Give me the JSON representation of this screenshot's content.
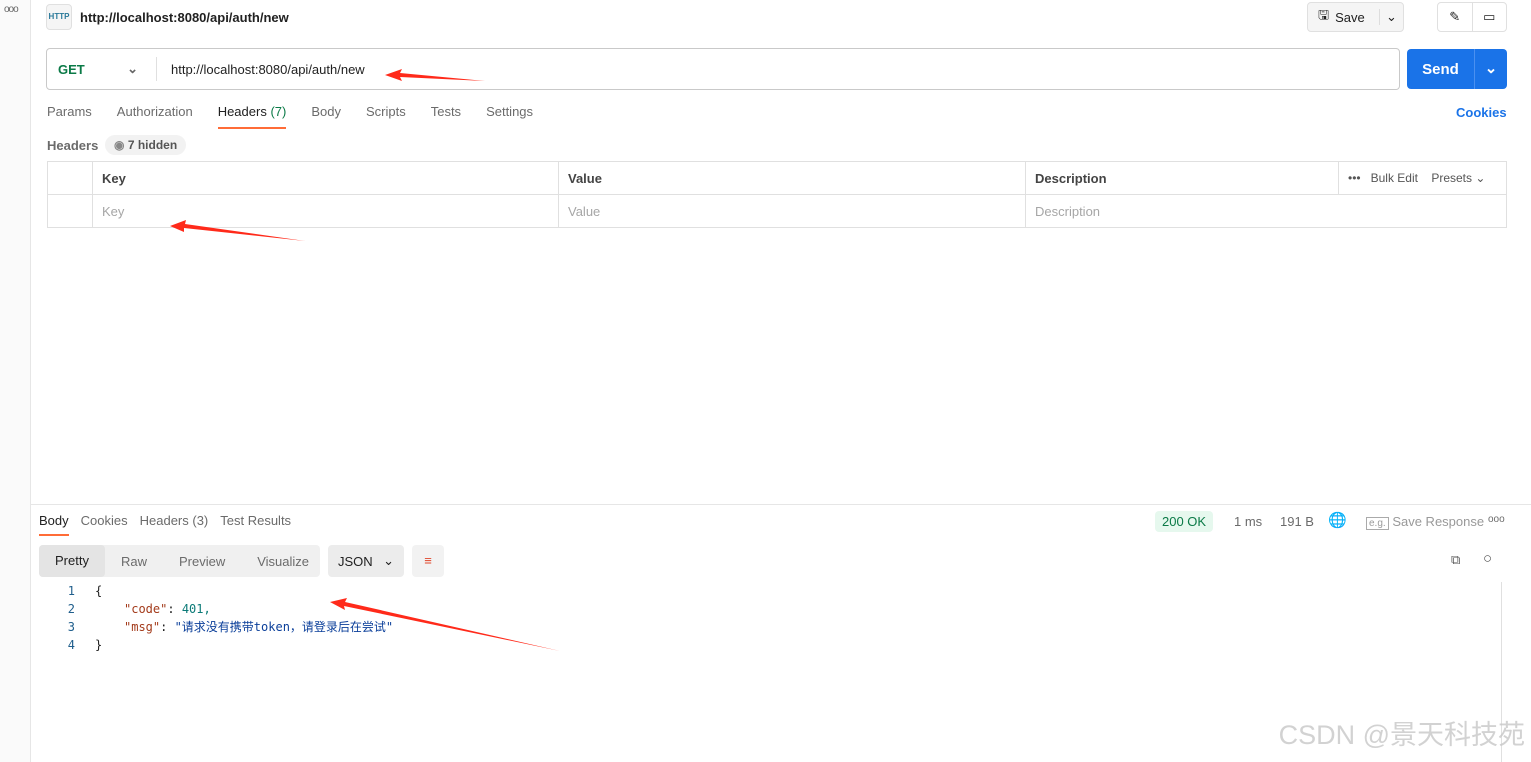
{
  "request": {
    "title": "http://localhost:8080/api/auth/new",
    "icon_text": "HTTP",
    "method": "GET",
    "url": "http://localhost:8080/api/auth/new",
    "save_label": "Save",
    "send_label": "Send"
  },
  "tabs": [
    {
      "label": "Params"
    },
    {
      "label": "Authorization"
    },
    {
      "label": "Headers",
      "count": "(7)"
    },
    {
      "label": "Body"
    },
    {
      "label": "Scripts"
    },
    {
      "label": "Tests"
    },
    {
      "label": "Settings"
    }
  ],
  "cookies_label": "Cookies",
  "headers": {
    "label": "Headers",
    "hidden": "7 hidden",
    "columns": [
      "Key",
      "Value",
      "Description"
    ],
    "bulk_edit": "Bulk Edit",
    "presets": "Presets",
    "placeholders": {
      "key": "Key",
      "value": "Value",
      "description": "Description"
    }
  },
  "response": {
    "tabs": [
      "Body",
      "Cookies",
      "Headers (3)",
      "Test Results"
    ],
    "status": "200 OK",
    "time": "1 ms",
    "size": "191 B",
    "save_response": "Save Response",
    "views": [
      "Pretty",
      "Raw",
      "Preview",
      "Visualize"
    ],
    "format": "JSON",
    "lines": [
      {
        "n": "1",
        "text": "{"
      },
      {
        "n": "2",
        "key": "\"code\"",
        "val": "401,"
      },
      {
        "n": "3",
        "key": "\"msg\"",
        "val": "\"请求没有携带token，请登录后在尝试\""
      },
      {
        "n": "4",
        "text": "}"
      }
    ]
  },
  "watermark": "CSDN @景天科技苑",
  "colors": {
    "accent": "#ff6c37",
    "send": "#1a73e8",
    "annotation_arrow": "#ff2a1a"
  }
}
